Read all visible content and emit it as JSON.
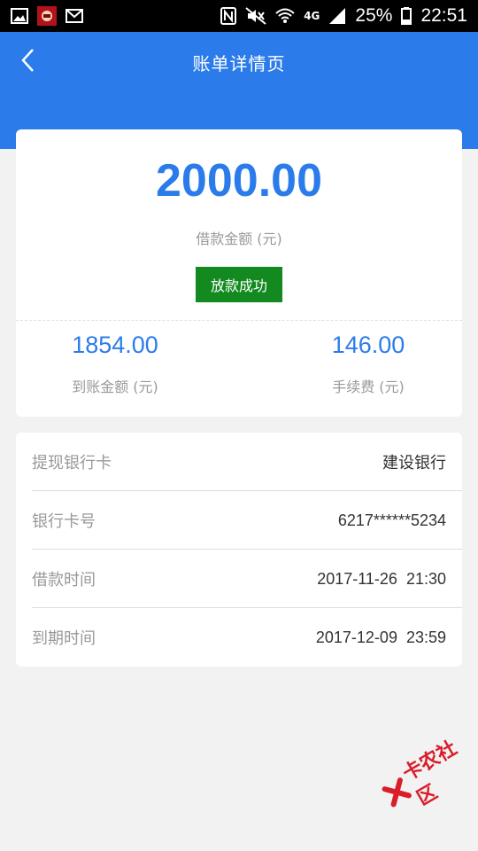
{
  "status_bar": {
    "battery": "25%",
    "time": "22:51",
    "network": "4G",
    "left_icons": [
      "image-icon",
      "app-icon",
      "mail-icon"
    ],
    "right_icons": [
      "nfc-icon",
      "mute-icon",
      "wifi-icon",
      "signal-icon",
      "battery-icon"
    ]
  },
  "header": {
    "title": "账单详情页",
    "background": "#2b7cea"
  },
  "summary": {
    "amount": "2000.00",
    "amount_label": "借款金额 (元)",
    "status": "放款成功",
    "status_color": "#138a20",
    "received_amount": "1854.00",
    "received_label": "到账金额 (元)",
    "fee": "146.00",
    "fee_label": "手续费 (元)"
  },
  "details": [
    {
      "label": "提现银行卡",
      "value": "建设银行"
    },
    {
      "label": "银行卡号",
      "value": "6217******5234"
    },
    {
      "label": "借款时间",
      "value": "2017-11-26  21:30"
    },
    {
      "label": "到期时间",
      "value": "2017-12-09  23:59"
    }
  ],
  "watermark": {
    "text": "卡农社区",
    "color": "#d91e2a"
  }
}
